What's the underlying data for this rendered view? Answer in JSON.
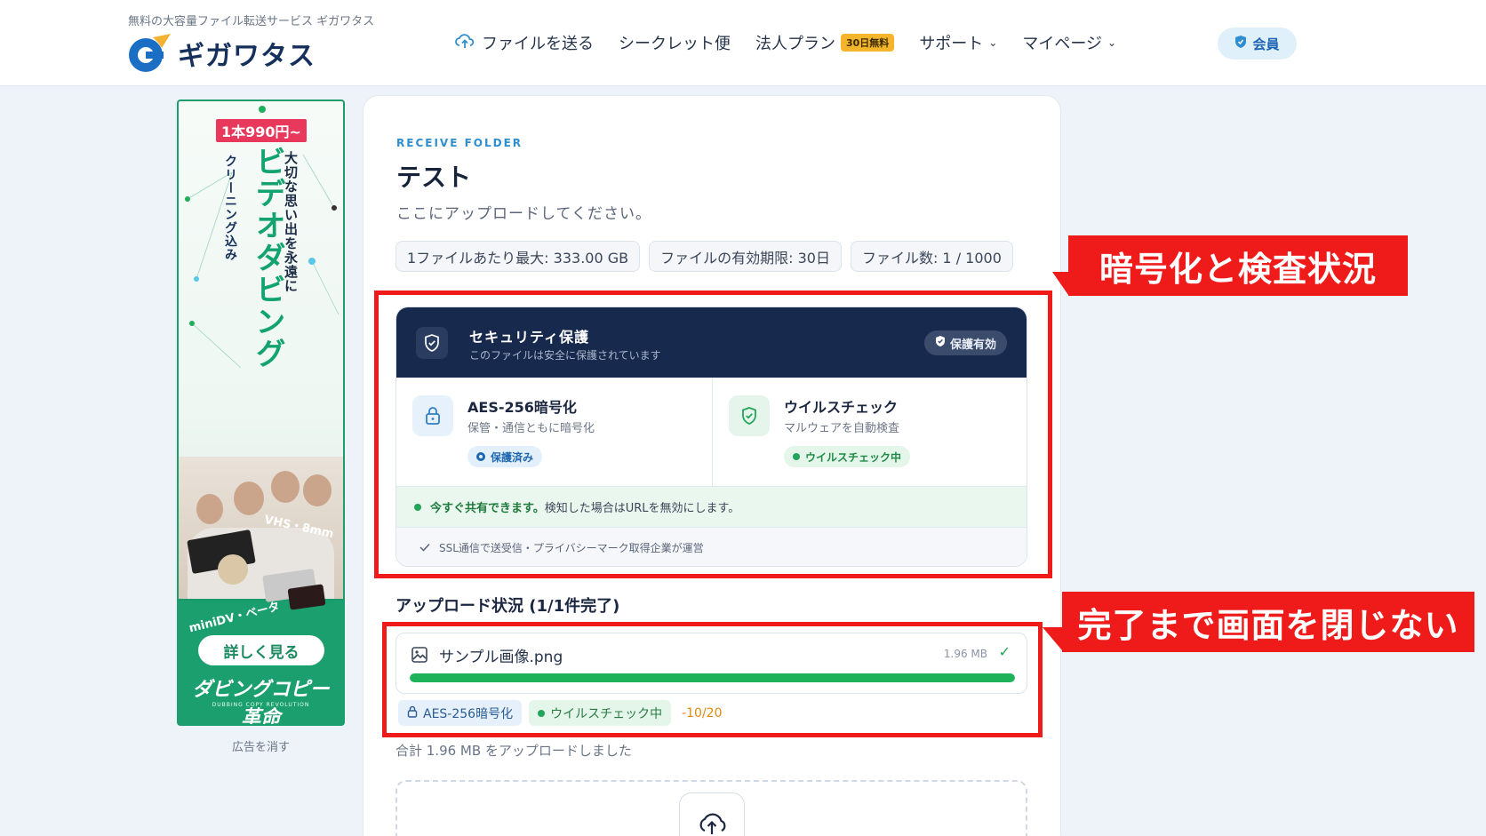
{
  "header": {
    "tagline": "無料の大容量ファイル転送サービス ギガワタス",
    "logo_text": "ギガワタス",
    "nav": [
      {
        "label": "ファイルを送る",
        "icon": "cloud-upload-icon"
      },
      {
        "label": "シークレット便"
      },
      {
        "label": "法人プラン",
        "badge": "30日無料"
      },
      {
        "label": "サポート",
        "dropdown": true
      },
      {
        "label": "マイページ",
        "dropdown": true
      }
    ],
    "member_label": "会員"
  },
  "ad": {
    "price": "1本990円~",
    "title": "ビデオダビング",
    "subtitle": "大切な思い出を永遠に",
    "subtitle2": "クリーニング込み",
    "formats_top": "VHS・8mm",
    "formats_bottom": "miniDV・ベータ",
    "cta": "詳しく見る",
    "brand": "ダビングコピー革命",
    "brand_en": "DUBBING COPY REVOLUTION",
    "remove": "広告を消す"
  },
  "main": {
    "eyebrow": "RECEIVE FOLDER",
    "title": "テスト",
    "description": "ここにアップロードしてください。",
    "chips": [
      "1ファイルあたり最大: 333.00 GB",
      "ファイルの有効期限: 30日",
      "ファイル数: 1 / 1000"
    ],
    "security": {
      "title": "セキュリティ保護",
      "subtitle": "このファイルは安全に保護されています",
      "badge": "保護有効",
      "encryption": {
        "title": "AES-256暗号化",
        "desc": "保管・通信ともに暗号化",
        "status": "保護済み"
      },
      "virus": {
        "title": "ウイルスチェック",
        "desc": "マルウェアを自動検査",
        "status": "ウイルスチェック中"
      },
      "share_strong": "今すぐ共有できます。",
      "share_rest": "検知した場合はURLを無効にします。",
      "ssl": "SSL通信で送受信・プライバシーマーク取得企業が運営"
    },
    "upload": {
      "title": "アップロード状況 (1/1件完了)",
      "file_name": "サンプル画像.png",
      "file_size": "1.96 MB",
      "progress": 1.0,
      "tag_encryption": "AES-256暗号化",
      "tag_virus": "ウイルスチェック中",
      "tag_count": "-10/20",
      "total": "合計 1.96 MB をアップロードしました"
    }
  },
  "annotations": {
    "callout1": "暗号化と検査状況",
    "callout2": "完了まで画面を閉じない",
    "color": "#ef1b1b"
  }
}
